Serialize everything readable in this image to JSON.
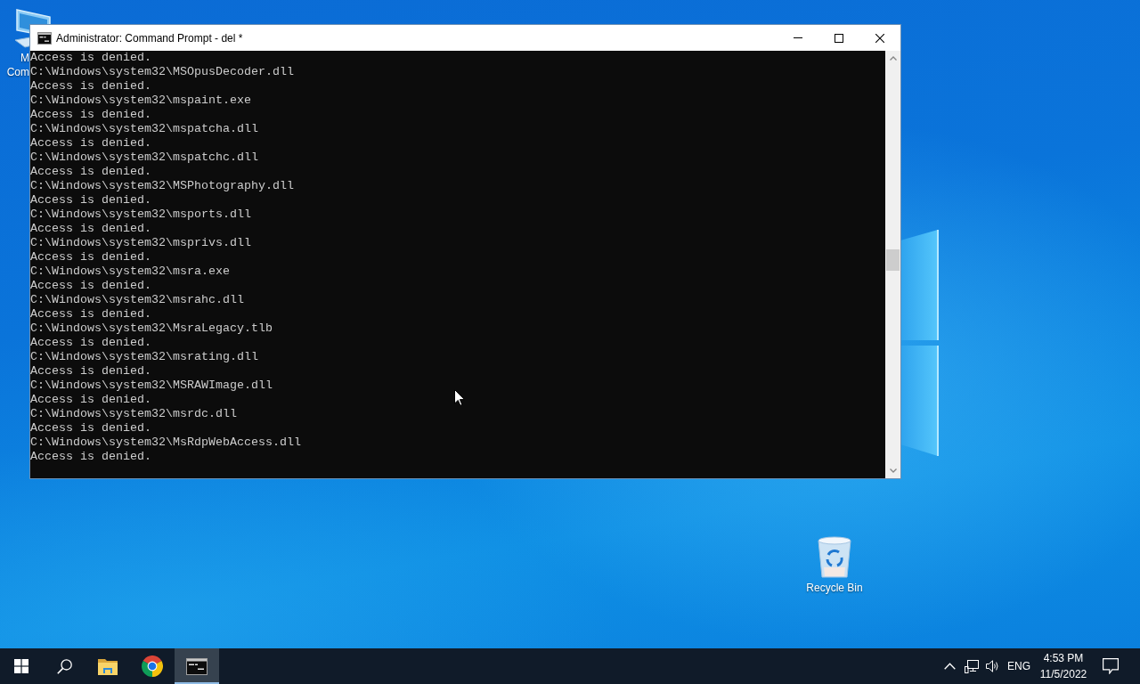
{
  "desktop_icons": [
    {
      "kind": "computer",
      "label_lines": [
        "M",
        "Com"
      ]
    },
    {
      "kind": "recycle_bin",
      "label_lines": [
        "Recycle Bin"
      ]
    }
  ],
  "window": {
    "title": "Administrator: Command Prompt - del *",
    "console_lines": [
      "Access is denied.",
      "C:\\Windows\\system32\\MSOpusDecoder.dll",
      "Access is denied.",
      "C:\\Windows\\system32\\mspaint.exe",
      "Access is denied.",
      "C:\\Windows\\system32\\mspatcha.dll",
      "Access is denied.",
      "C:\\Windows\\system32\\mspatchc.dll",
      "Access is denied.",
      "C:\\Windows\\system32\\MSPhotography.dll",
      "Access is denied.",
      "C:\\Windows\\system32\\msports.dll",
      "Access is denied.",
      "C:\\Windows\\system32\\msprivs.dll",
      "Access is denied.",
      "C:\\Windows\\system32\\msra.exe",
      "Access is denied.",
      "C:\\Windows\\system32\\msrahc.dll",
      "Access is denied.",
      "C:\\Windows\\system32\\MsraLegacy.tlb",
      "Access is denied.",
      "C:\\Windows\\system32\\msrating.dll",
      "Access is denied.",
      "C:\\Windows\\system32\\MSRAWImage.dll",
      "Access is denied.",
      "C:\\Windows\\system32\\msrdc.dll",
      "Access is denied.",
      "C:\\Windows\\system32\\MsRdpWebAccess.dll",
      "Access is denied."
    ]
  },
  "taskbar": {
    "apps": [
      {
        "kind": "start",
        "active": false
      },
      {
        "kind": "search",
        "active": false
      },
      {
        "kind": "file_explorer",
        "active": false
      },
      {
        "kind": "chrome",
        "active": false
      },
      {
        "kind": "command_prompt",
        "active": true
      }
    ],
    "tray": {
      "language": "ENG",
      "time": "4:53 PM",
      "date": "11/5/2022"
    }
  }
}
